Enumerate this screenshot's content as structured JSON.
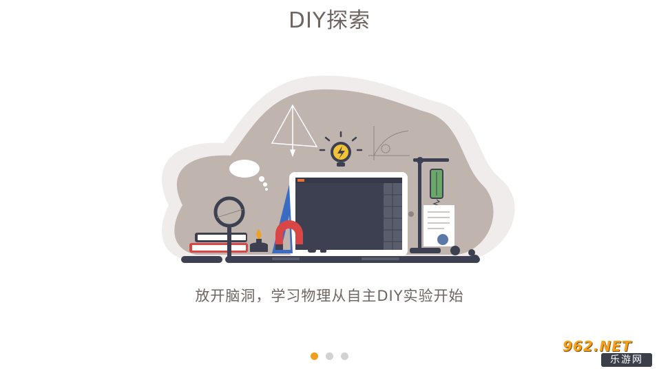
{
  "header": {
    "title": "DIY探索"
  },
  "main": {
    "illustration_label": "lab-desk",
    "subtitle": "放开脑洞，学习物理从自主DIY实验开始"
  },
  "pager": {
    "pages": 3,
    "current": 1,
    "dot_active_color": "#f0a020",
    "dot_inactive_color": "#d2d2d2"
  },
  "watermark": {
    "logo_text": "962.NET",
    "site_text": "乐游网"
  },
  "colors": {
    "text": "#6e6560",
    "blob": "#bfb4ae",
    "dark": "#3d4050",
    "accent_blue": "#3b6cc4",
    "accent_red": "#d84646",
    "accent_yellow": "#f2c237"
  }
}
